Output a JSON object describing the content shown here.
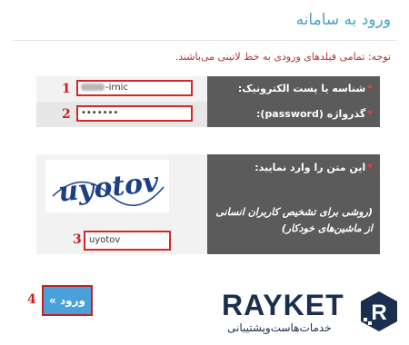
{
  "page": {
    "title": "ورود به سامانه",
    "note": "توجه: تمامی فیلدهای ورودی به خط لاتینی می‌باشند."
  },
  "form": {
    "email": {
      "label": "شناسه یا پست الکترونیک:",
      "value": "-irnic",
      "step": "1"
    },
    "password": {
      "label": "گذرواژه (password):",
      "value": "•••••••",
      "step": "2"
    },
    "captcha": {
      "label": "این متن را وارد نمایید:",
      "hint": "(روشی برای تشخیص کاربران انسانی از ماشین‌های خودکار)",
      "image_text": "uyotov",
      "value": "uyotov",
      "step": "3"
    },
    "required_mark": "*"
  },
  "submit": {
    "label": "ورود »",
    "step": "4"
  },
  "brand": {
    "name": "RAYKET",
    "tagline": "خدمات‌هاست‌وپشتیبانی",
    "logo_letter": "R",
    "color": "#1a2f4f"
  }
}
